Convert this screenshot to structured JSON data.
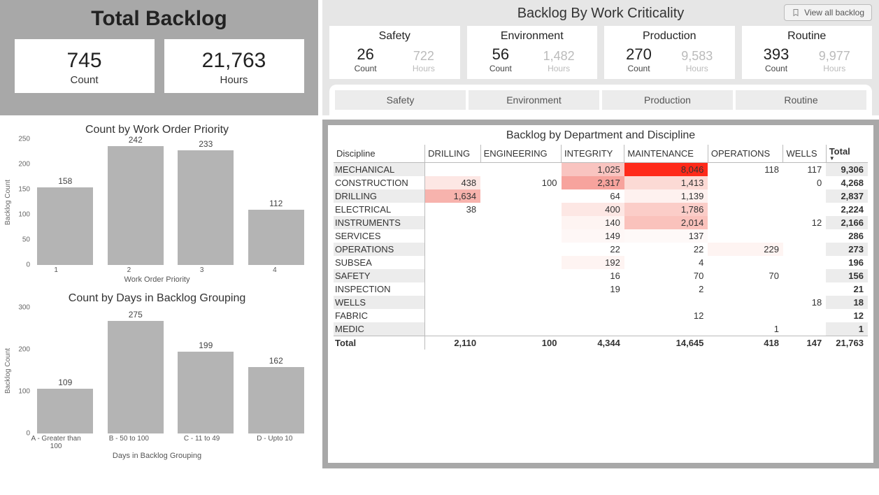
{
  "total_backlog": {
    "title": "Total Backlog",
    "count": {
      "value": "745",
      "label": "Count"
    },
    "hours": {
      "value": "21,763",
      "label": "Hours"
    }
  },
  "criticality": {
    "title": "Backlog By Work Criticality",
    "view_all": "View all backlog",
    "cards": [
      {
        "name": "Safety",
        "count": "26",
        "hours": "722"
      },
      {
        "name": "Environment",
        "count": "56",
        "hours": "1,482"
      },
      {
        "name": "Production",
        "count": "270",
        "hours": "9,583"
      },
      {
        "name": "Routine",
        "count": "393",
        "hours": "9,977"
      }
    ],
    "count_label": "Count",
    "hours_label": "Hours",
    "tabs": [
      "Safety",
      "Environment",
      "Production",
      "Routine"
    ]
  },
  "matrix": {
    "title": "Backlog by Department and Discipline",
    "row_header": "Discipline",
    "departments": [
      "DRILLING",
      "ENGINEERING",
      "INTEGRITY",
      "MAINTENANCE",
      "OPERATIONS",
      "WELLS"
    ],
    "total_label": "Total",
    "rows": [
      {
        "label": "MECHANICAL",
        "cells": [
          "",
          "",
          "1,025",
          "8,046",
          "118",
          "117"
        ],
        "total": "9,306",
        "colors": [
          "",
          "",
          "#f9c4c0",
          "#ff2a1a",
          "",
          ""
        ]
      },
      {
        "label": "CONSTRUCTION",
        "cells": [
          "438",
          "100",
          "2,317",
          "1,413",
          "",
          "0"
        ],
        "total": "4,268",
        "colors": [
          "#fde7e4",
          "",
          "#f7a39d",
          "#fcdad5",
          "",
          ""
        ]
      },
      {
        "label": "DRILLING",
        "cells": [
          "1,634",
          "",
          "64",
          "1,139",
          "",
          ""
        ],
        "total": "2,837",
        "colors": [
          "#f7b3ad",
          "",
          "",
          "#fef1ef",
          "",
          ""
        ]
      },
      {
        "label": "ELECTRICAL",
        "cells": [
          "38",
          "",
          "400",
          "1,786",
          "",
          ""
        ],
        "total": "2,224",
        "colors": [
          "",
          "",
          "#fde7e4",
          "#fbcdc8",
          "",
          ""
        ]
      },
      {
        "label": "INSTRUMENTS",
        "cells": [
          "",
          "",
          "140",
          "2,014",
          "",
          "12"
        ],
        "total": "2,166",
        "colors": [
          "",
          "",
          "#fef4f2",
          "#fac2bc",
          "",
          ""
        ]
      },
      {
        "label": "SERVICES",
        "cells": [
          "",
          "",
          "149",
          "137",
          "",
          ""
        ],
        "total": "286",
        "colors": [
          "",
          "",
          "#fef7f6",
          "#fef9f8",
          "",
          ""
        ]
      },
      {
        "label": "OPERATIONS",
        "cells": [
          "",
          "",
          "22",
          "22",
          "229",
          ""
        ],
        "total": "273",
        "colors": [
          "",
          "",
          "",
          "",
          "#fef4f2",
          ""
        ]
      },
      {
        "label": "SUBSEA",
        "cells": [
          "",
          "",
          "192",
          "4",
          "",
          ""
        ],
        "total": "196",
        "colors": [
          "",
          "",
          "#fef4f2",
          "",
          "",
          ""
        ]
      },
      {
        "label": "SAFETY",
        "cells": [
          "",
          "",
          "16",
          "70",
          "70",
          ""
        ],
        "total": "156",
        "colors": [
          "",
          "",
          "",
          "",
          "",
          ""
        ]
      },
      {
        "label": "INSPECTION",
        "cells": [
          "",
          "",
          "19",
          "2",
          "",
          ""
        ],
        "total": "21",
        "colors": [
          "",
          "",
          "",
          "",
          "",
          ""
        ]
      },
      {
        "label": "WELLS",
        "cells": [
          "",
          "",
          "",
          "",
          "",
          "18"
        ],
        "total": "18",
        "colors": [
          "",
          "",
          "",
          "",
          "",
          ""
        ]
      },
      {
        "label": "FABRIC",
        "cells": [
          "",
          "",
          "",
          "12",
          "",
          ""
        ],
        "total": "12",
        "colors": [
          "",
          "",
          "",
          "",
          "",
          ""
        ]
      },
      {
        "label": "MEDIC",
        "cells": [
          "",
          "",
          "",
          "",
          "1",
          ""
        ],
        "total": "1",
        "colors": [
          "",
          "",
          "",
          "",
          "",
          ""
        ]
      }
    ],
    "grand": {
      "label": "Total",
      "cells": [
        "2,110",
        "100",
        "4,344",
        "14,645",
        "418",
        "147"
      ],
      "total": "21,763"
    }
  },
  "chart_data": [
    {
      "type": "bar",
      "title": "Count by Work Order Priority",
      "xlabel": "Work Order Priority",
      "ylabel": "Backlog Count",
      "ylim": [
        0,
        250
      ],
      "yticks": [
        0,
        50,
        100,
        150,
        200,
        250
      ],
      "categories": [
        "1",
        "2",
        "3",
        "4"
      ],
      "values": [
        158,
        242,
        233,
        112
      ]
    },
    {
      "type": "bar",
      "title": "Count by Days in Backlog Grouping",
      "xlabel": "Days in Backlog Grouping",
      "ylabel": "Backlog Count",
      "ylim": [
        0,
        300
      ],
      "yticks": [
        0,
        100,
        200,
        300
      ],
      "categories": [
        "A - Greater than 100",
        "B - 50 to 100",
        "C - 11 to 49",
        "D - Upto 10"
      ],
      "values": [
        109,
        275,
        199,
        162
      ]
    }
  ]
}
